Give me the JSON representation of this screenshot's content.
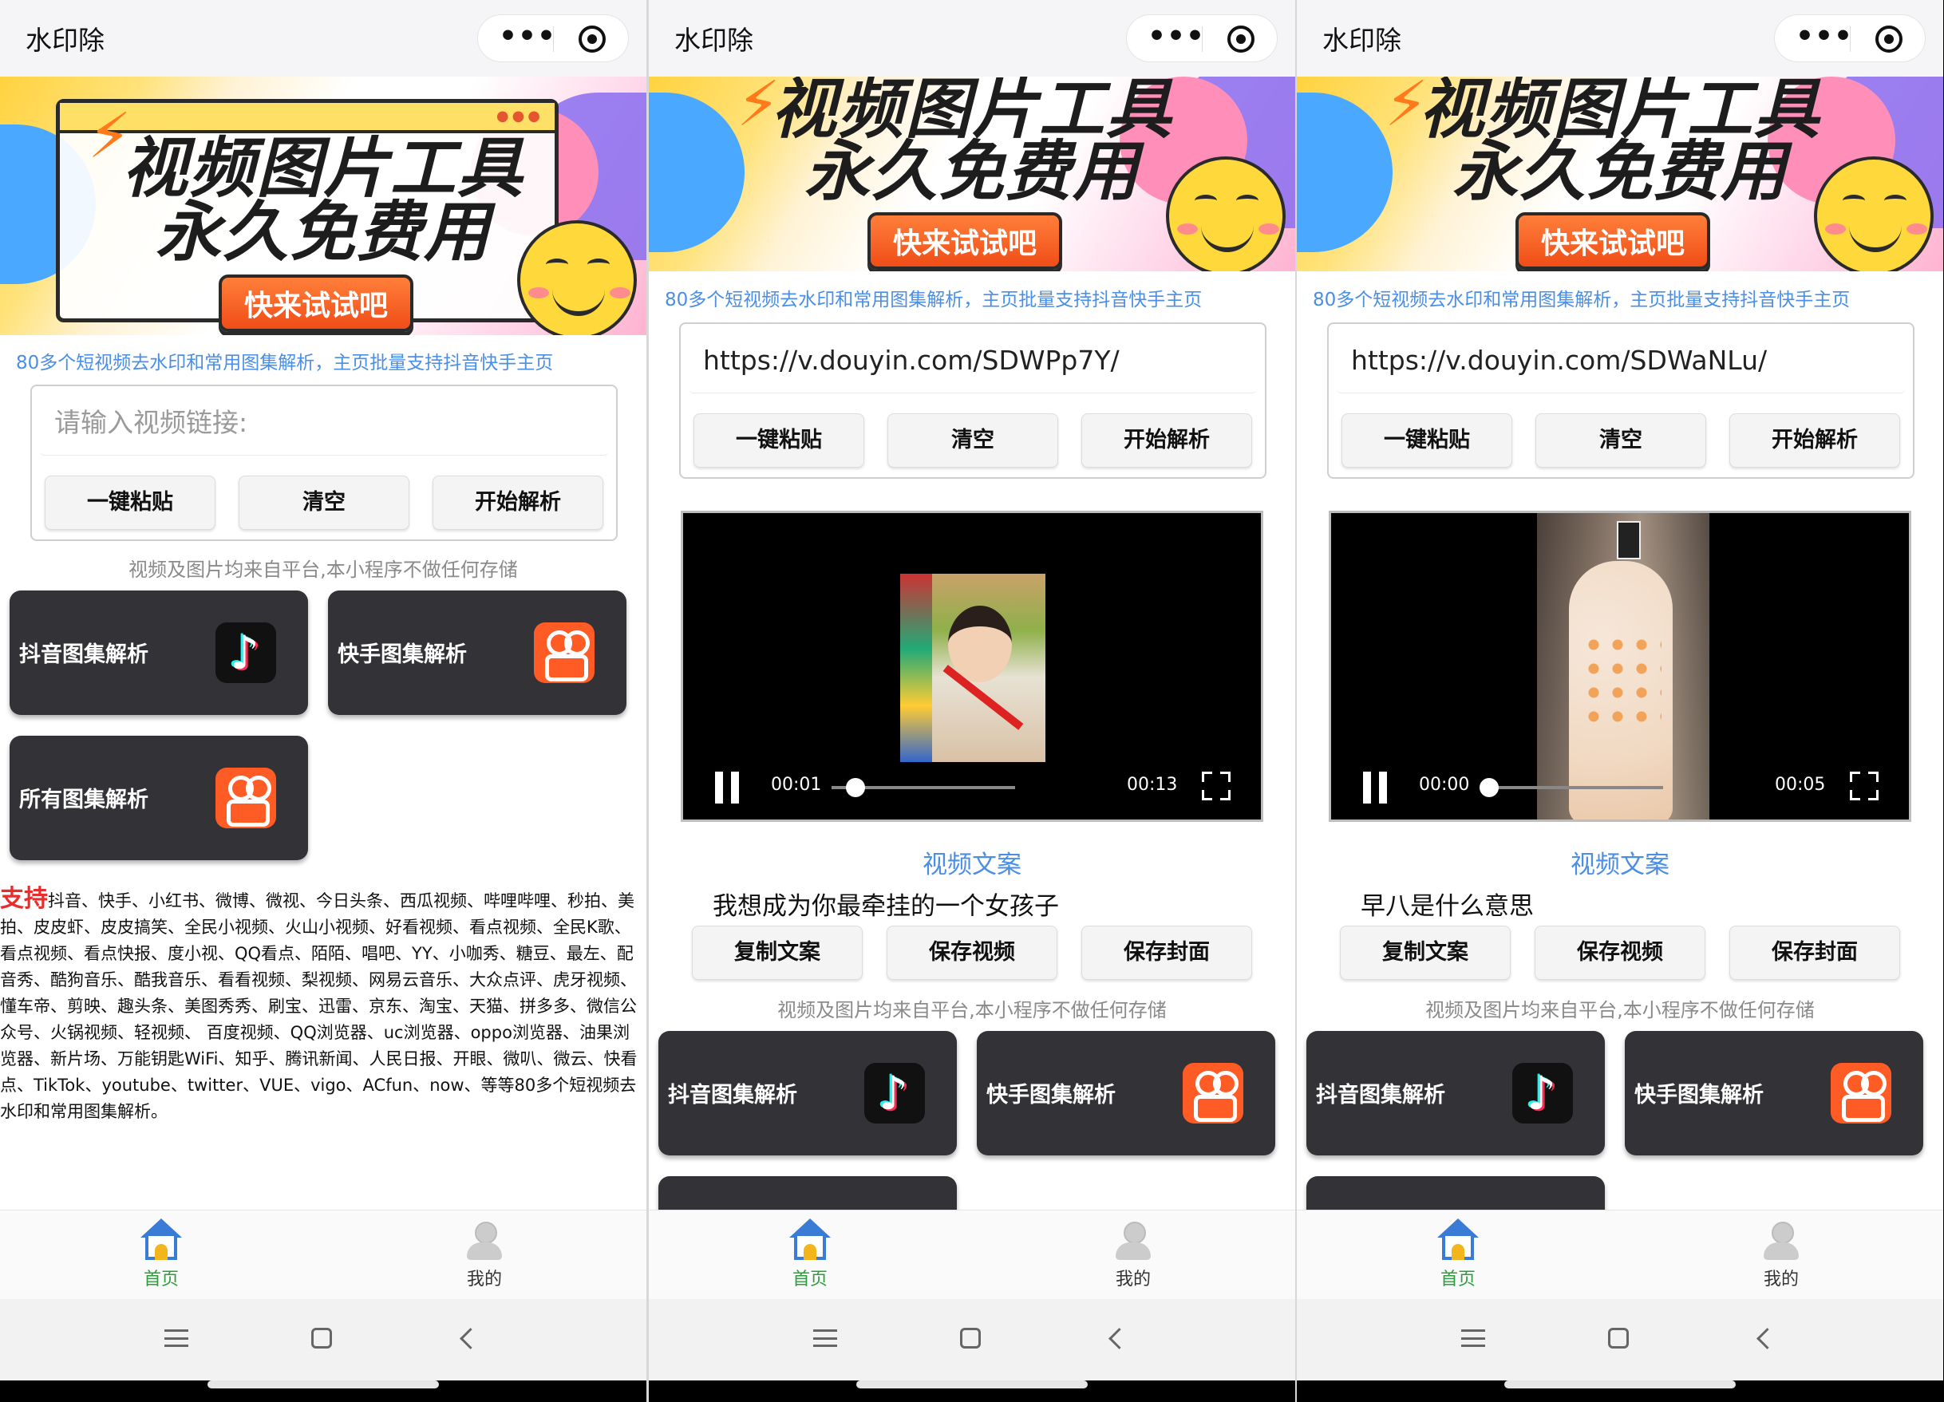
{
  "app": {
    "title": "水印除"
  },
  "banner": {
    "line1": "视频图片工具",
    "line2": "永久免费用",
    "cta": "快来试试吧"
  },
  "subline": "80多个短视频去水印和常用图集解析，主页批量支持抖音快手主页",
  "input": {
    "placeholder": "请输入视频链接:"
  },
  "buttons": {
    "paste": "一键粘贴",
    "clear": "清空",
    "parse": "开始解析"
  },
  "note": "视频及图片均来自平台,本小程序不做任何存储",
  "tiles": {
    "douyin": "抖音图集解析",
    "kuaishou": "快手图集解析",
    "all": "所有图集解析"
  },
  "support": {
    "tag": "支持",
    "text": "抖音、快手、小红书、微博、微视、今日头条、西瓜视频、哔哩哔哩、秒拍、美拍、皮皮虾、皮皮搞笑、全民小视频、火山小视频、好看视频、看点视频、全民K歌、看点视频、看点快报、度小视、QQ看点、陌陌、唱吧、YY、小咖秀、糖豆、最左、配音秀、酷狗音乐、酷我音乐、看看视频、梨视频、网易云音乐、大众点评、虎牙视频、懂车帝、剪映、趣头条、美图秀秀、刷宝、迅雷、京东、淘宝、天猫、拼多多、微信公众号、火锅视频、轻视频、 百度视频、QQ浏览器、uc浏览器、oppo浏览器、油果浏览器、新片场、万能钥匙WiFi、知乎、腾讯新闻、人民日报、开眼、微叭、微云、快看点、TikTok、youtube、twitter、VUE、vigo、ACfun、now、等等80多个短视频去水印和常用图集解析。"
  },
  "screens": [
    {
      "url": "https://v.douyin.com/SDWPp7Y/",
      "time_current": "00:01",
      "time_total": "00:13",
      "progress": 0.077,
      "caption": "我想成为你最牵挂的一个女孩子"
    },
    {
      "url": "https://v.douyin.com/SDWaNLu/",
      "time_current": "00:00",
      "time_total": "00:05",
      "progress": 0.0,
      "caption": "早八是什么意思"
    }
  ],
  "video_section": {
    "title": "视频文案"
  },
  "actions": {
    "copy": "复制文案",
    "save_video": "保存视频",
    "save_cover": "保存封面"
  },
  "tabbar": {
    "home": "首页",
    "me": "我的"
  },
  "colors": {
    "accent_blue": "#4a8ee6",
    "tile_bg": "#333236",
    "support_red": "#e62e2e",
    "tab_active": "#2d9c3c"
  }
}
